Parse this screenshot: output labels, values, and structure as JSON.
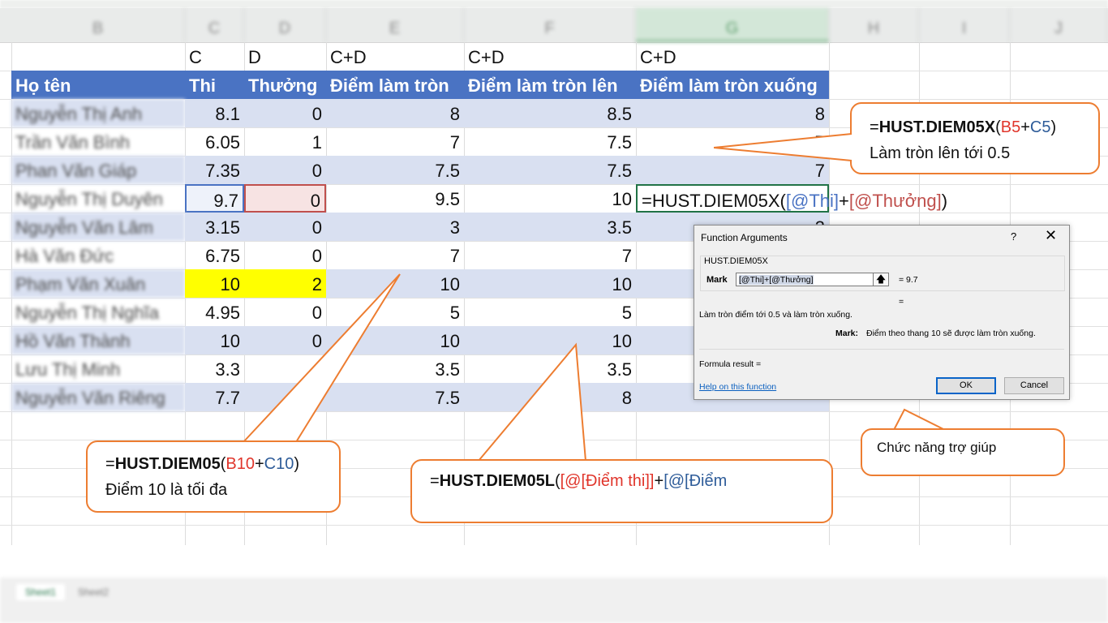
{
  "column_headers": [
    "B",
    "C",
    "D",
    "E",
    "F",
    "G",
    "H",
    "I",
    "J"
  ],
  "selected_column": "G",
  "label_row": [
    "C",
    "D",
    "C+D",
    "C+D",
    "C+D"
  ],
  "table_headers": [
    "Họ tên",
    "Thi",
    "Thưởng",
    "Điểm làm tròn",
    "Điểm làm tròn lên",
    "Điểm làm tròn xuống"
  ],
  "rows": [
    {
      "name": "Nguyễn Thị Anh",
      "thi": "8.1",
      "thuong": "0",
      "e": "8",
      "f": "8.5",
      "g": "8"
    },
    {
      "name": "Trần Văn Bình",
      "thi": "6.05",
      "thuong": "1",
      "e": "7",
      "f": "7.5",
      "g": "7"
    },
    {
      "name": "Phan Văn Giáp",
      "thi": "7.35",
      "thuong": "0",
      "e": "7.5",
      "f": "7.5",
      "g": "7"
    },
    {
      "name": "Nguyễn Thị Duyên",
      "thi": "9.7",
      "thuong": "0",
      "e": "9.5",
      "f": "10",
      "g": ""
    },
    {
      "name": "Nguyễn Văn Lâm",
      "thi": "3.15",
      "thuong": "0",
      "e": "3",
      "f": "3.5",
      "g": "3"
    },
    {
      "name": "Hà Văn Đức",
      "thi": "6.75",
      "thuong": "0",
      "e": "7",
      "f": "7",
      "g": ""
    },
    {
      "name": "Phạm Văn Xuân",
      "thi": "10",
      "thuong": "2",
      "e": "10",
      "f": "10",
      "g": ""
    },
    {
      "name": "Nguyễn Thị Nghĩa",
      "thi": "4.95",
      "thuong": "0",
      "e": "5",
      "f": "5",
      "g": ""
    },
    {
      "name": "Hồ Văn Thành",
      "thi": "10",
      "thuong": "0",
      "e": "10",
      "f": "10",
      "g": ""
    },
    {
      "name": "Lưu Thị Minh",
      "thi": "3.3",
      "thuong": "",
      "e": "3.5",
      "f": "3.5",
      "g": ""
    },
    {
      "name": "Nguyễn Văn Riêng",
      "thi": "7.7",
      "thuong": "",
      "e": "7.5",
      "f": "8",
      "g": ""
    }
  ],
  "formula_cell": {
    "prefix": "=HUST.DIEM05X(",
    "ref1": "[@Thi]",
    "plus": "+",
    "ref2": "[@Thưởng]",
    "suffix": ")"
  },
  "callouts": {
    "top_right": {
      "eq": "=",
      "fn": "HUST.DIEM05X",
      "open": "(",
      "a": "B5",
      "plus": "+",
      "b": "C5",
      "close": ")",
      "line2": "Làm tròn lên tới 0.5"
    },
    "bottom_left": {
      "eq": "=",
      "fn": "HUST.DIEM05",
      "open": "(",
      "a": "B10",
      "plus": "+",
      "b": "C10",
      "close": ")",
      "line2": "Điểm 10 là tối đa"
    },
    "bottom_mid": {
      "eq": "=",
      "fn": "HUST.DIEM05L",
      "open": "(",
      "a": "[@[Điểm thi]]",
      "plus": "+",
      "b": "[@[Điểm"
    },
    "help": {
      "text": "Chức năng trợ giúp"
    }
  },
  "dialog": {
    "title": "Function Arguments",
    "question_mark": "?",
    "close_glyph": "✕",
    "function_name": "HUST.DIEM05X",
    "arg_label": "Mark",
    "arg_value": "[@Thi]+[@Thưởng]",
    "arg_result": "=  9.7",
    "eq_blank": "=",
    "description": "Làm tròn điểm tới 0.5 và làm tròn xuống.",
    "arg_desc_label": "Mark:",
    "arg_desc": "Điểm theo thang 10 sẽ được làm tròn xuống.",
    "formula_result": "Formula result =",
    "help_link": "Help on this function",
    "ok": "OK",
    "cancel": "Cancel"
  },
  "sheet_tabs": [
    "Sheet1",
    "Sheet2"
  ],
  "colors": {
    "header_blue": "#4a73c3",
    "band": "#d9e0f1",
    "callout_orange": "#ed7d31",
    "highlight_yellow": "#ffff00"
  }
}
